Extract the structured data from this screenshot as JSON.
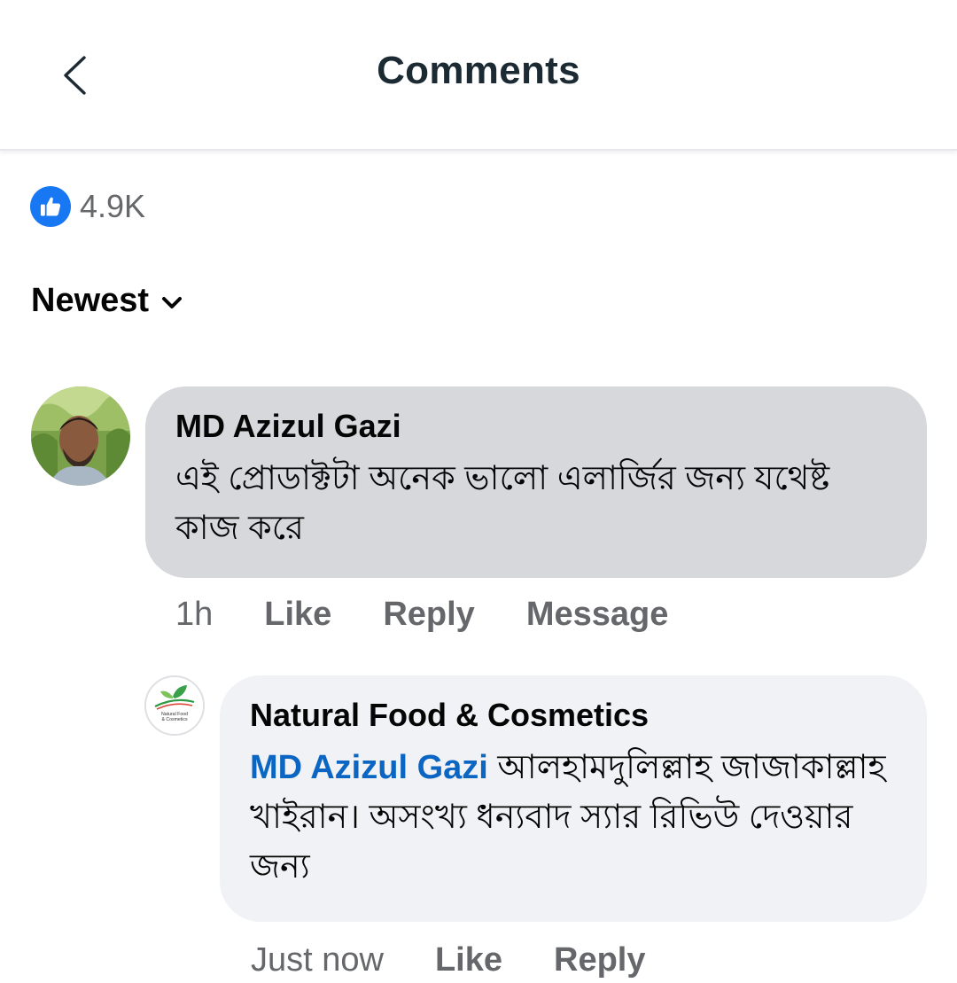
{
  "header": {
    "title": "Comments"
  },
  "reactions": {
    "icon": "like-icon",
    "count": "4.9K",
    "color": "#1877f2"
  },
  "sort": {
    "label": "Newest"
  },
  "comments": [
    {
      "author": "MD Azizul Gazi",
      "text": "এই প্রোডাক্টটা অনেক ভালো এলার্জির জন্য যথেষ্ট কাজ করে",
      "time": "1h",
      "actions": [
        "Like",
        "Reply",
        "Message"
      ],
      "replies": [
        {
          "author": "Natural Food & Cosmetics",
          "mention": "MD Azizul Gazi",
          "text": "আলহামদুলিল্লাহ জাজাকাল্লাহ খাইরান। অসংখ্য ধন্যবাদ স্যার রিভিউ দেওয়ার জন্য",
          "time": "Just now",
          "actions": [
            "Like",
            "Reply"
          ],
          "avatar_text": [
            "Natural Food",
            "& Cosmetics"
          ]
        }
      ]
    }
  ],
  "colors": {
    "bubble_main": "#d6d8dc",
    "bubble_reply": "#f0f2f5",
    "mention": "#0a66c2",
    "muted_text": "#65676b"
  }
}
